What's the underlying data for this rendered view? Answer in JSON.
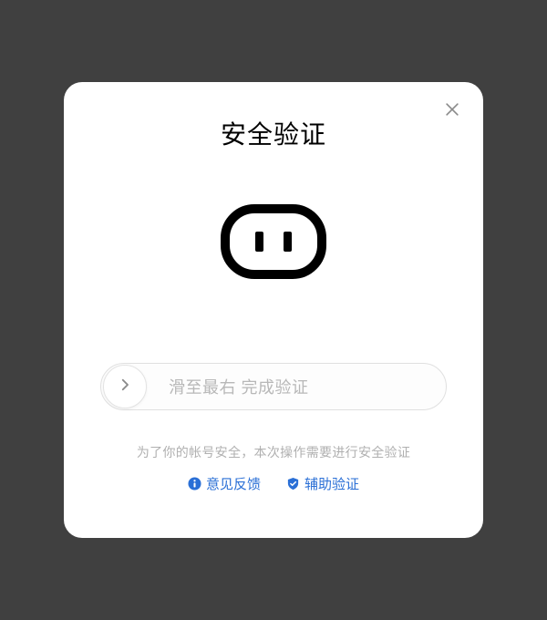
{
  "modal": {
    "title": "安全验证",
    "slider_text": "滑至最右 完成验证",
    "hint": "为了你的帐号安全，本次操作需要进行安全验证",
    "feedback_link": "意见反馈",
    "assist_link": "辅助验证"
  },
  "colors": {
    "link": "#2a6fd6",
    "hint": "#b0b0b0",
    "slider_text": "#b8b8b8"
  }
}
